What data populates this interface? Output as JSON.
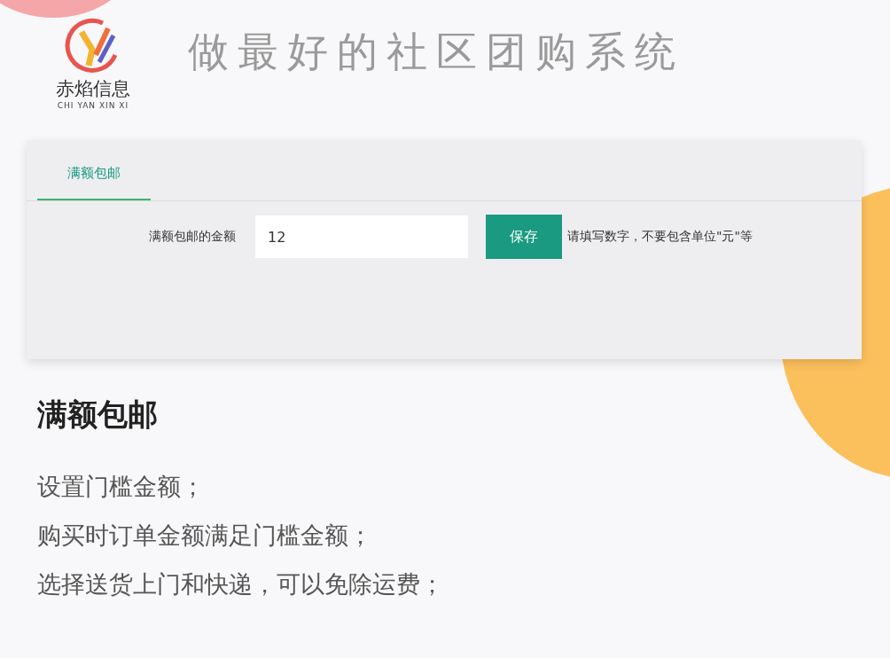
{
  "logo": {
    "name": "赤焰信息",
    "pinyin": "CHI YAN XIN XI"
  },
  "title": "做最好的社区团购系统",
  "panel": {
    "tabs": [
      {
        "label": "满额包邮",
        "selected": true
      }
    ],
    "form": {
      "label": "满额包邮的金额",
      "value": "12",
      "button": "保存",
      "hint": "请填写数字，不要包含单位\"元\"等"
    }
  },
  "feature": {
    "heading": "满额包邮",
    "lines": [
      "设置门槛金额；",
      "购买时订单金额满足门槛金额；",
      "选择送货上门和快递，可以免除运费；"
    ]
  }
}
